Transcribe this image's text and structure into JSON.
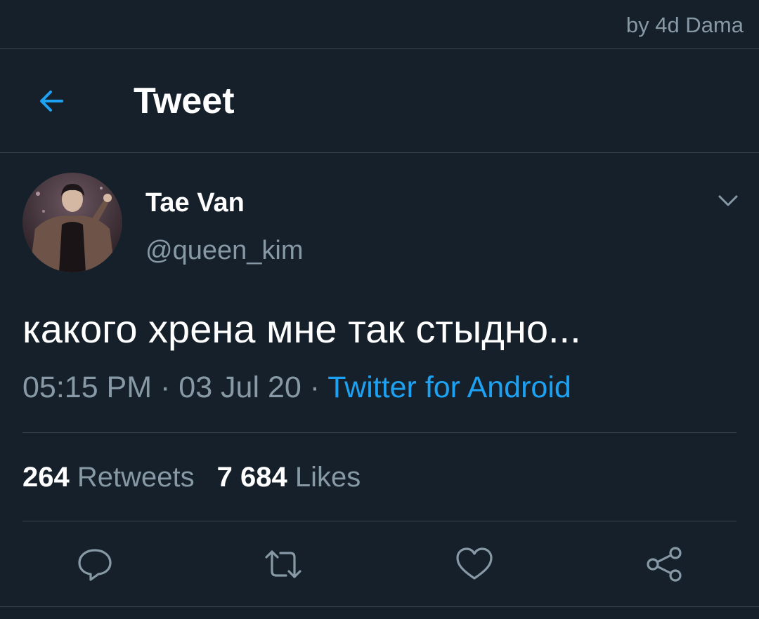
{
  "watermark": "by 4d Dama",
  "header": {
    "title": "Tweet",
    "back_icon": "arrow-left-icon"
  },
  "tweet": {
    "author_name": "Tae Van",
    "author_handle": "@queen_kim",
    "text": "какого хрена мне так стыдно...",
    "time": "05:15 PM",
    "date": "03 Jul 20",
    "source": "Twitter for Android",
    "separator": " · ",
    "retweets_count": "264",
    "retweets_label": "Retweets",
    "likes_count": "7 684",
    "likes_label": "Likes"
  },
  "actions": {
    "reply_icon": "reply-icon",
    "retweet_icon": "retweet-icon",
    "like_icon": "heart-icon",
    "share_icon": "share-icon"
  },
  "colors": {
    "background": "#15202b",
    "accent": "#1da1f2",
    "muted_text": "#8899a6",
    "divider": "#38444d"
  }
}
